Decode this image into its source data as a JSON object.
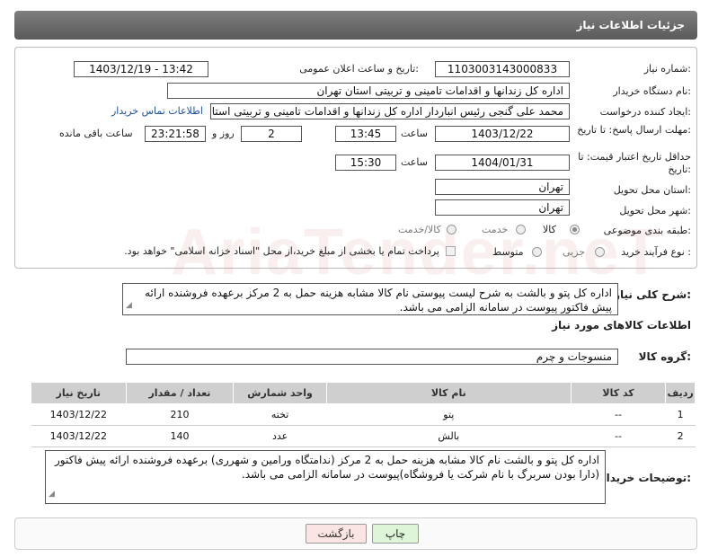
{
  "header": {
    "title": "جزئیات اطلاعات نیاز"
  },
  "form": {
    "need_number_label": "شماره نیاز:",
    "need_number": "1103003143000833",
    "announce_label": "تاریخ و ساعت اعلان عمومی:",
    "announce_value": "1403/12/19 - 13:42",
    "buyer_org_label": "نام دستگاه خریدار:",
    "buyer_org": "اداره کل زندانها و اقدامات تامینی و تربیتی استان تهران",
    "requester_label": "ایجاد کننده درخواست:",
    "requester": "محمد علی گنجی رئیس انباردار  اداره کل زندانها و اقدامات تامینی و تربیتی استان تهران",
    "contact_link": "اطلاعات تماس خریدار",
    "deadline_label": "مهلت ارسال پاسخ: تا تاریخ:",
    "deadline_date": "1403/12/22",
    "time_label": "ساعت",
    "deadline_time": "13:45",
    "days_value": "2",
    "days_label": "روز و",
    "remaining_value": "23:21:58",
    "remaining_label": "ساعت باقی مانده",
    "validity_label": "حداقل تاریخ اعتبار قیمت: تا تاریخ:",
    "validity_date": "1404/01/31",
    "validity_time": "15:30",
    "province_label": "استان محل تحویل:",
    "province": "تهران",
    "city_label": "شهر محل تحویل:",
    "city": "تهران",
    "category_label": "طبقه بندی موضوعی:",
    "category_options": [
      "کالا",
      "خدمت",
      "کالا/خدمت"
    ],
    "process_label": "نوع فرآیند خرید :",
    "process_options": [
      "جزیی",
      "متوسط"
    ],
    "payment_note": "پرداخت تمام یا بخشی از مبلغ خرید،از محل \"اسناد خزانه اسلامی\" خواهد بود."
  },
  "summary": {
    "label": "شرح کلی نیاز:",
    "text": "اداره کل پتو و بالشت به شرح لیست پیوستی نام کالا مشابه هزینه حمل به 2 مرکز برعهده فروشنده ارائه پیش فاکتور پیوست در سامانه الزامی می باشد."
  },
  "goods": {
    "section_title": "اطلاعات کالاهای مورد نیاز",
    "group_label": "گروه کالا:",
    "group_value": "منسوجات و چرم",
    "columns": [
      "ردیف",
      "کد کالا",
      "نام کالا",
      "واحد شمارش",
      "تعداد / مقدار",
      "تاریخ نیاز"
    ],
    "rows": [
      {
        "idx": "1",
        "code": "--",
        "name": "پتو",
        "unit": "تخته",
        "qty": "210",
        "date": "1403/12/22"
      },
      {
        "idx": "2",
        "code": "--",
        "name": "بالش",
        "unit": "عدد",
        "qty": "140",
        "date": "1403/12/22"
      }
    ]
  },
  "buyer_notes": {
    "label": "توضیحات خریدار:",
    "text": "اداره کل پتو و بالشت نام کالا مشابه هزینه حمل به 2 مرکز (ندامتگاه ورامین و شهرری) برعهده فروشنده ارائه پیش فاکتور (دارا بودن سربرگ با نام شرکت یا فروشگاه)پیوست در سامانه الزامی می باشد."
  },
  "buttons": {
    "print": "چاپ",
    "back": "بازگشت"
  },
  "watermark": "AriaTender.neT",
  "colors": {
    "header": "#6b6b6b",
    "print_btn": "#dff5d8",
    "back_btn": "#fbe4e4",
    "link": "#1a4fa0"
  }
}
